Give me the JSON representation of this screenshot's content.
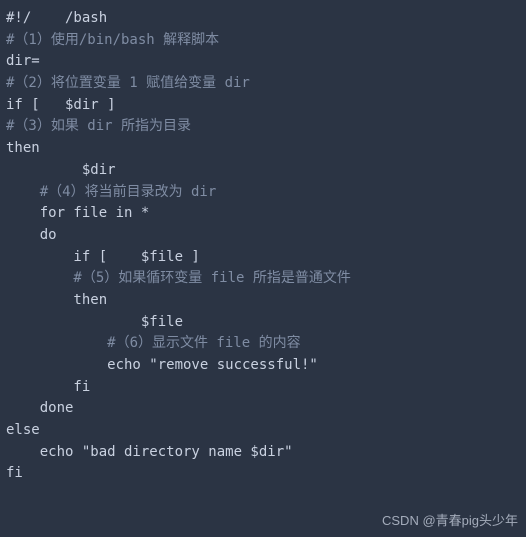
{
  "code": {
    "lines": [
      "#!/    /bash",
      "#（1）使用/bin/bash 解释脚本",
      "dir=",
      "#（2）将位置变量 1 赋值给变量 dir",
      "if [   $dir ]",
      "#（3）如果 dir 所指为目录",
      "then",
      "         $dir",
      "    #（4）将当前目录改为 dir",
      "    for file in *",
      "    do",
      "        if [    $file ]",
      "        #（5）如果循环变量 file 所指是普通文件",
      "        then",
      "                $file",
      "            #（6）显示文件 file 的内容",
      "            echo \"remove successful!\"",
      "        fi",
      "    done",
      "else",
      "    echo \"bad directory name $dir\"",
      "fi"
    ]
  },
  "watermark": "CSDN @青春pig头少年"
}
